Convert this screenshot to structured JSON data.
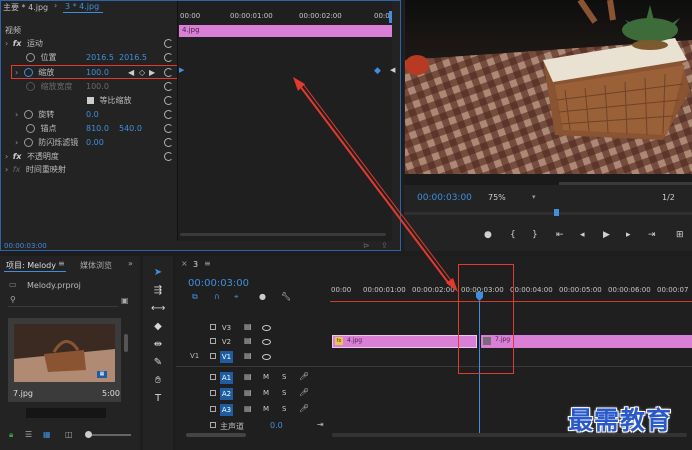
{
  "effect_controls": {
    "tab_master": "主要 * 4.jpg",
    "tab_seq": "3 * 4.jpg",
    "section_video": "视频",
    "motion": "运动",
    "position": {
      "label": "位置",
      "x": "2016.5",
      "y": "2016.5"
    },
    "scale": {
      "label": "缩放",
      "value": "100.0"
    },
    "scale_width": {
      "label": "缩放宽度",
      "value": "100.0"
    },
    "uniform_scale": "等比缩放",
    "rotation": {
      "label": "旋转",
      "value": "0.0"
    },
    "anchor": {
      "label": "锚点",
      "x": "810.0",
      "y": "540.0"
    },
    "anti_flicker": {
      "label": "防闪烁滤镜",
      "value": "0.00"
    },
    "opacity": "不透明度",
    "time_remap": "时间重映射",
    "timecode": "00:00:03:00",
    "ruler": [
      "00:00",
      "00:00:01:00",
      "00:00:02:00",
      "00:0"
    ],
    "clip_label": "4.jpg"
  },
  "program": {
    "timecode": "00:00:03:00",
    "zoom": "75%",
    "fraction": "1/2"
  },
  "project": {
    "tab_project": "项目: Melody",
    "tab_media": "媒体浏览",
    "file": "Melody.prproj",
    "thumb_name": "7.jpg",
    "thumb_duration": "5:00"
  },
  "timeline": {
    "tab": "3",
    "timecode": "00:00:03:00",
    "ruler": [
      "00:00",
      "00:00:01:00",
      "00:00:02:00",
      "00:00:03:00",
      "00:00:04:00",
      "00:00:05:00",
      "00:00:06:00",
      "00:00:07"
    ],
    "tracks_video": [
      "V3",
      "V2",
      "V1"
    ],
    "tracks_audio": [
      "A1",
      "A2",
      "A3"
    ],
    "v1_source": "V1",
    "clip1": "4.jpg",
    "clip2": "7.jpg",
    "master": "主声道",
    "master_value": "0.0"
  },
  "watermark": "最需教育"
}
